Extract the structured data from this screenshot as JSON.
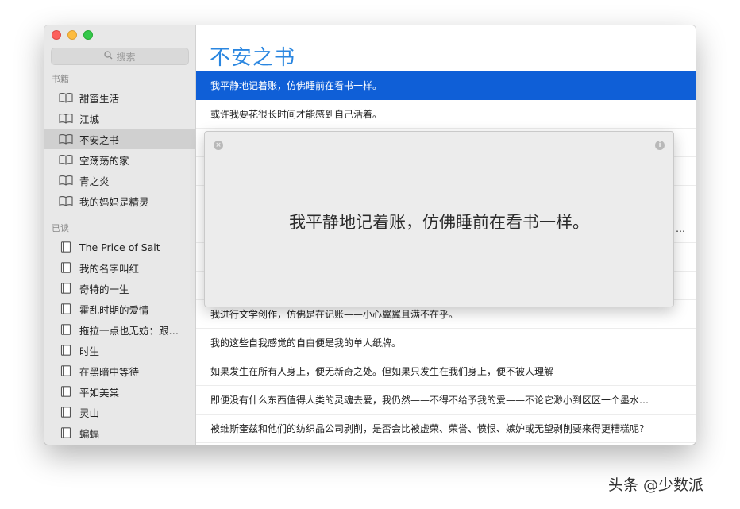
{
  "sidebar": {
    "search_placeholder": "搜索",
    "books_header": "书籍",
    "books": [
      {
        "label": "甜蜜生活",
        "icon": "book-open-icon"
      },
      {
        "label": "江城",
        "icon": "book-open-icon"
      },
      {
        "label": "不安之书",
        "icon": "book-open-icon",
        "selected": true
      },
      {
        "label": "空荡荡的家",
        "icon": "book-open-icon"
      },
      {
        "label": "青之炎",
        "icon": "book-open-icon"
      },
      {
        "label": "我的妈妈是精灵",
        "icon": "book-open-icon"
      }
    ],
    "read_header": "已读",
    "read": [
      {
        "label": "The Price of Salt",
        "icon": "book-closed-icon"
      },
      {
        "label": "我的名字叫红",
        "icon": "book-closed-icon"
      },
      {
        "label": "奇特的一生",
        "icon": "book-closed-icon"
      },
      {
        "label": "霍乱时期的爱情",
        "icon": "book-closed-icon"
      },
      {
        "label": "拖拉一点也无妨：跟…",
        "icon": "book-closed-icon"
      },
      {
        "label": "时生",
        "icon": "book-closed-icon"
      },
      {
        "label": "在黑暗中等待",
        "icon": "book-closed-icon"
      },
      {
        "label": "平如美棠",
        "icon": "book-closed-icon"
      },
      {
        "label": "灵山",
        "icon": "book-closed-icon"
      },
      {
        "label": "蝙蝠",
        "icon": "book-closed-icon"
      }
    ]
  },
  "main": {
    "title": "不安之书",
    "quotes": [
      {
        "text": "我平静地记着账，仿佛睡前在看书一样。",
        "selected": true
      },
      {
        "text": "或许我要花很长时间才能感到自己活着。"
      },
      {
        "text": ""
      },
      {
        "text": ""
      },
      {
        "text": ""
      },
      {
        "text": "…"
      },
      {
        "text": ""
      },
      {
        "text": ""
      },
      {
        "text": "我进行文学创作，仿佛是在记账——小心翼翼且满不在乎。"
      },
      {
        "text": "我的这些自我感觉的自白便是我的单人纸牌。"
      },
      {
        "text": "如果发生在所有人身上，便无新奇之处。但如果只发生在我们身上，便不被人理解"
      },
      {
        "text": "即便没有什么东西值得人类的灵魂去爱，我仍然——不得不给予我的爱——不论它渺小到区区一个墨水…"
      },
      {
        "text": "被维斯奎兹和他们的纺织品公司剥削，是否会比被虚荣、荣誉、愤恨、嫉妒或无望剥削要来得更糟糕呢?"
      }
    ]
  },
  "popover": {
    "text": "我平静地记着账，仿佛睡前在看书一样。",
    "close_icon": "close-icon",
    "info_icon": "info-icon",
    "close_glyph": "×",
    "info_glyph": "i"
  },
  "watermark": "头条 @少数派",
  "colors": {
    "accent": "#2a86e0",
    "selection": "#0f5fd7",
    "sidebar_bg": "#e8e8e8"
  }
}
